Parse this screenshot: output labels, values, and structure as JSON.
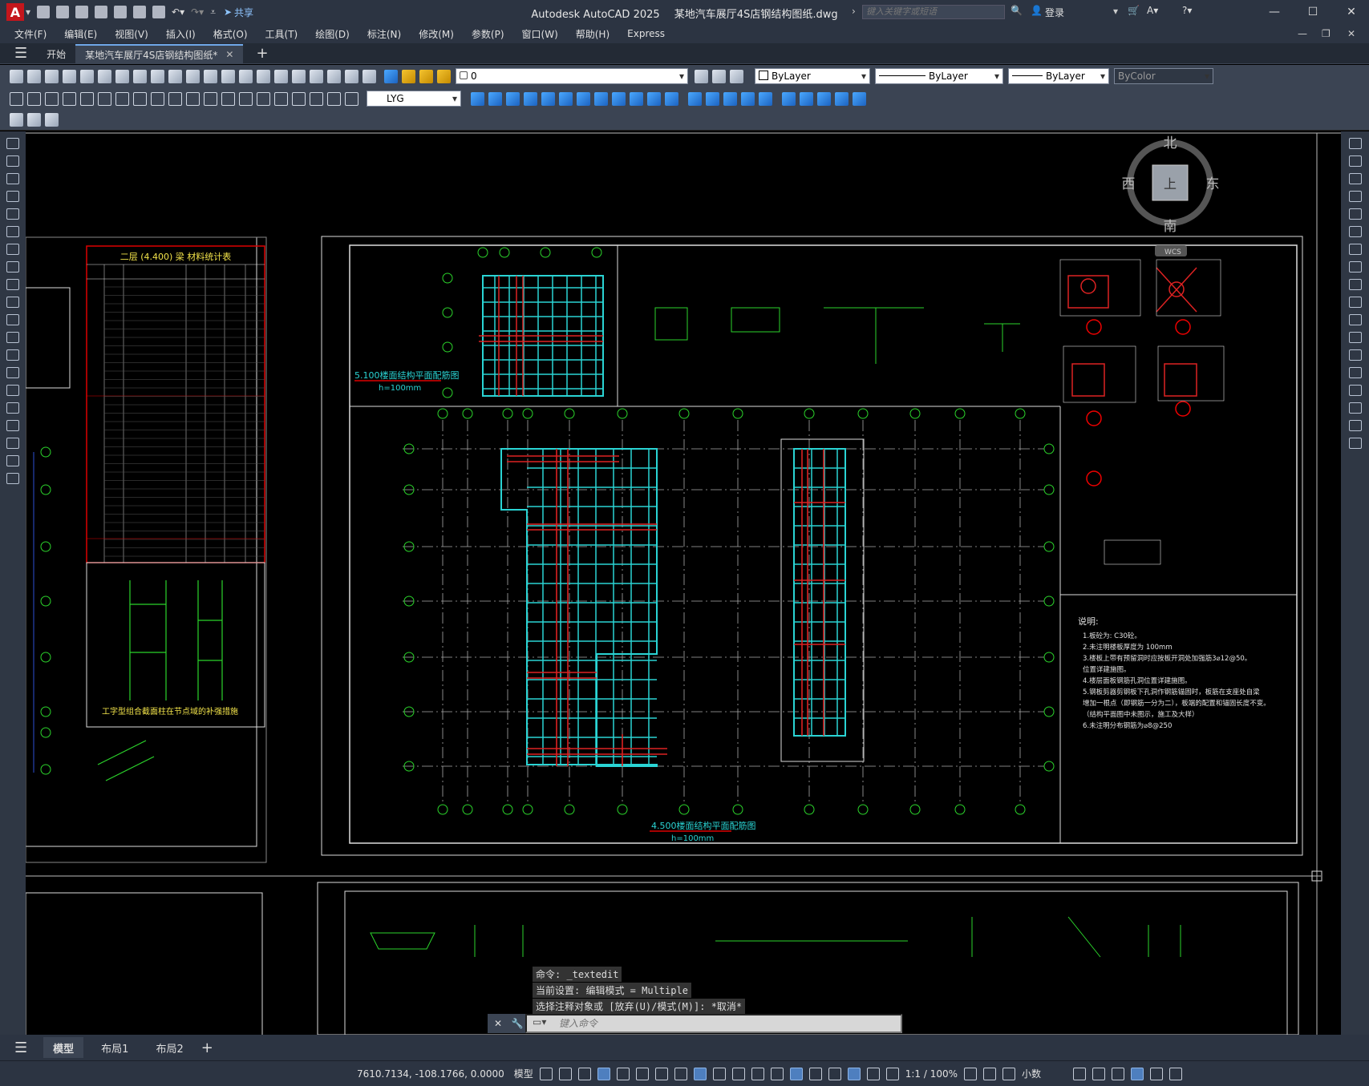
{
  "titlebar": {
    "app_title": "Autodesk AutoCAD 2025",
    "file_name": "某地汽车展厅4S店钢结构图纸.dwg",
    "share_label": "共享",
    "search_placeholder": "键入关键字或短语",
    "login_label": "登录"
  },
  "menubar": {
    "items": [
      "文件(F)",
      "编辑(E)",
      "视图(V)",
      "插入(I)",
      "格式(O)",
      "工具(T)",
      "绘图(D)",
      "标注(N)",
      "修改(M)",
      "参数(P)",
      "窗口(W)",
      "帮助(H)",
      "Express"
    ]
  },
  "doc_tabs": {
    "start": "开始",
    "active": "某地汽车展厅4S店钢结构图纸*"
  },
  "toolbar": {
    "layer_value": "0",
    "color_value": "ByLayer",
    "linetype_value": "ByLayer",
    "lineweight_value": "ByLayer",
    "plotstyle_value": "ByColor",
    "dimstyle_value": "LYG"
  },
  "viewcube": {
    "north": "北",
    "south": "南",
    "east": "东",
    "west": "西",
    "top": "上",
    "wcs": "WCS"
  },
  "drawing": {
    "table_title": "二层 (4.400) 梁 材料统计表",
    "plan_top_title": "5.100楼面结构平面配筋图",
    "plan_top_sub": "h=100mm",
    "plan_main_title": "4.500楼面结构平面配筋图",
    "plan_main_sub": "h=100mm",
    "detail_title": "工字型组合截面柱在节点域的补强措施",
    "notes_title": "说明:",
    "notes": [
      "1.板砼为: C30砼。",
      "2.未注明楼板厚度为 100mm",
      "3.楼板上带有预留洞时应按板开洞处加强筋3⌀12@50。",
      "  位置详建施图。",
      "4.楼层面板钢筋孔洞位置详建施图。",
      "5.钢板剪器剪钢板下孔洞作钢筋锚固时，板筋在支座处自梁",
      "  增加一根点（即钢筋一分为二），板端的配置和锚固长度不变。",
      "  （结构平面图中未图示，施工及大样）",
      "6.未注明分布钢筋为⌀8@250"
    ]
  },
  "command": {
    "line1": "命令:  _textedit",
    "line2": "当前设置: 编辑模式 = Multiple",
    "line3": "选择注释对象或 [放弃(U)/模式(M)]: *取消*",
    "input_placeholder": "键入命令"
  },
  "layout_tabs": [
    "模型",
    "布局1",
    "布局2"
  ],
  "status": {
    "coords": "7610.7134, -108.1766, 0.0000",
    "model_label": "模型",
    "scale": "1:1 / 100%",
    "units": "小数"
  }
}
